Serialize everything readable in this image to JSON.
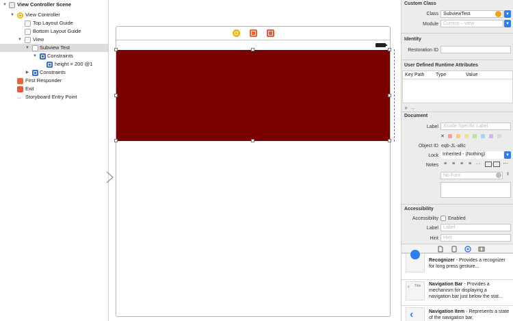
{
  "outline": {
    "items": [
      {
        "label": "View Controller Scene",
        "icon": "scene-icon"
      },
      {
        "label": "View Controller",
        "icon": "view-controller-icon"
      },
      {
        "label": "Top Layout Guide",
        "icon": "layout-guide-icon"
      },
      {
        "label": "Bottom Layout Guide",
        "icon": "layout-guide-icon"
      },
      {
        "label": "View",
        "icon": "view-icon"
      },
      {
        "label": "Subview Test",
        "icon": "view-icon"
      },
      {
        "label": "Constraints",
        "icon": "constraints-icon"
      },
      {
        "label": "height = 200 @1",
        "icon": "constraint-icon"
      },
      {
        "label": "Constraints",
        "icon": "constraints-icon"
      },
      {
        "label": "First Responder",
        "icon": "first-responder-icon"
      },
      {
        "label": "Exit",
        "icon": "exit-icon"
      },
      {
        "label": "Storyboard Entry Point",
        "icon": "arrow-icon"
      }
    ]
  },
  "canvas": {
    "subview_color": "#7a0000"
  },
  "inspector": {
    "custom_class": {
      "title": "Custom Class",
      "class_label": "Class",
      "class_value": "SubviewTest",
      "module_label": "Module",
      "module_placeholder": "Current – view"
    },
    "identity": {
      "title": "Identity",
      "restoration_label": "Restoration ID"
    },
    "runtime_attrs": {
      "title": "User Defined Runtime Attributes",
      "col_keypath": "Key Path",
      "col_type": "Type",
      "col_value": "Value",
      "add": "+",
      "remove": "–"
    },
    "document": {
      "title": "Document",
      "label_label": "Label",
      "label_placeholder": "Xcode Specific Label",
      "clear_glyph": "✕",
      "object_id_label": "Object ID",
      "object_id_value": "eqb-JL-aBc",
      "lock_label": "Lock",
      "lock_value": "Inherited - (Nothing)",
      "notes_label": "Notes",
      "font_placeholder": "No Font",
      "swatch_colors": [
        "#f2a29a",
        "#f6c98a",
        "#f3e08c",
        "#bfe3a0",
        "#a9d2f2",
        "#c9b8ec",
        "#d9d9d9"
      ]
    },
    "accessibility": {
      "title": "Accessibility",
      "accessibility_label": "Accessibility",
      "enabled_label": "Enabled",
      "label_label": "Label",
      "label_placeholder": "Label",
      "hint_label": "Hint",
      "hint_placeholder": "Hint"
    },
    "library": {
      "items": [
        {
          "name": "Recognizer",
          "desc": " - Provides a recognizer for long press gesture..."
        },
        {
          "name": "Navigation Bar",
          "desc": " - Provides a mechanism for displaying a navigation bar just below the stat..."
        },
        {
          "name": "Navigation Item",
          "desc": " - Represents a state of the navigation bar,"
        }
      ],
      "nav_bar_thumb_text": "Title"
    }
  }
}
